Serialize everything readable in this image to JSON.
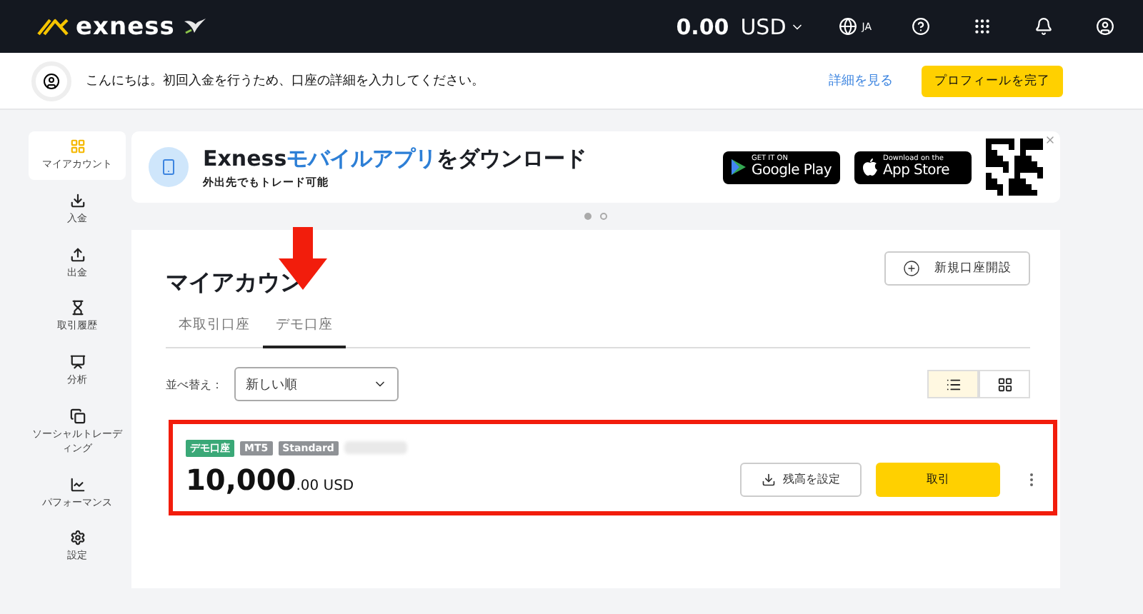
{
  "header": {
    "logo": "exness",
    "balance": "0.00",
    "currency": "USD",
    "language": "JA"
  },
  "notice": {
    "message": "こんにちは。初回入金を行うため、口座の詳細を入力してください。",
    "link": "詳細を見る",
    "button": "プロフィールを完了"
  },
  "sidebar": {
    "items": [
      {
        "label": "マイアカウント",
        "kind": "apps",
        "selected": true
      },
      {
        "label": "入金",
        "kind": "deposit",
        "selected": false
      },
      {
        "label": "出金",
        "kind": "withdraw",
        "selected": false
      },
      {
        "label": "取引履歴",
        "kind": "history",
        "selected": false
      },
      {
        "label": "分析",
        "kind": "analytics",
        "selected": false
      },
      {
        "label": "ソーシャルトレーディング",
        "kind": "social",
        "selected": false
      },
      {
        "label": "パフォーマンス",
        "kind": "performance",
        "selected": false
      },
      {
        "label": "設定",
        "kind": "settings",
        "selected": false
      }
    ]
  },
  "banner": {
    "title_start": "Exness",
    "title_highlight": "モバイルアプリ",
    "title_end": "をダウンロード",
    "subtitle": "外出先でもトレード可能",
    "google_play": {
      "small": "GET IT ON",
      "large": "Google Play"
    },
    "app_store": {
      "small": "Download on the",
      "large": "App Store"
    },
    "dots": [
      {
        "selected": true
      },
      {
        "selected": false
      }
    ]
  },
  "accounts": {
    "title": "マイアカウン",
    "new_account_button": "新規口座開設",
    "tabs": [
      {
        "label": "本取引口座",
        "selected": false
      },
      {
        "label": "デモ口座",
        "selected": true
      }
    ],
    "sort_label": "並べ替え：",
    "sort_value": "新しい順",
    "view_toggles": [
      {
        "kind": "list",
        "selected": true
      },
      {
        "kind": "grid",
        "selected": false
      }
    ],
    "account": {
      "tags": [
        {
          "label": "デモ口座",
          "color": "#3aa877"
        },
        {
          "label": "MT5",
          "color": "#8f9296"
        },
        {
          "label": "Standard",
          "color": "#8f9296"
        }
      ],
      "balance_whole": "10,000",
      "balance_fraction": ".00 USD",
      "set_balance_button": "残高を設定",
      "trade_button": "取引"
    }
  }
}
